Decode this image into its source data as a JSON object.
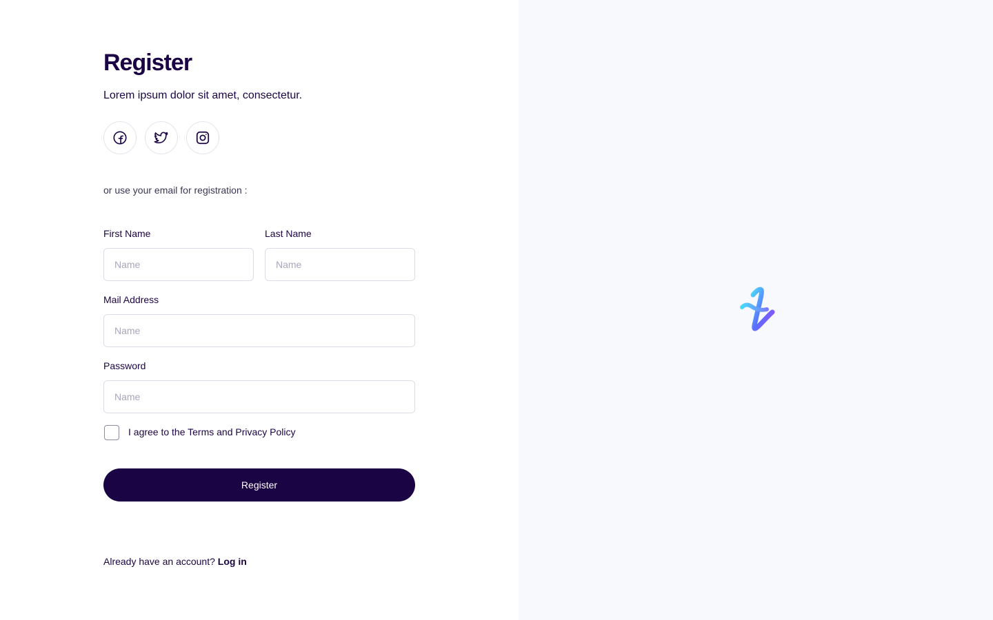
{
  "form": {
    "title": "Register",
    "subtitle": "Lorem ipsum dolor sit amet, consectetur.",
    "social": [
      {
        "icon": "facebook-icon"
      },
      {
        "icon": "twitter-icon"
      },
      {
        "icon": "instagram-icon"
      }
    ],
    "divider_text": "or use your email for registration :",
    "first_name": {
      "label": "First Name",
      "placeholder": "Name",
      "value": ""
    },
    "last_name": {
      "label": "Last Name",
      "placeholder": "Name",
      "value": ""
    },
    "email": {
      "label": "Mail Address",
      "placeholder": "Name",
      "value": ""
    },
    "password": {
      "label": "Password",
      "placeholder": "Name",
      "value": ""
    },
    "terms": {
      "label": "I agree to the Terms and Privacy Policy",
      "checked": false
    },
    "submit_label": "Register",
    "footer": {
      "prompt": "Already have an account?",
      "link": "Log in"
    }
  },
  "brand": {
    "logo_icon": "brand-logo-icon"
  },
  "colors": {
    "primary": "#1b0444",
    "panel_bg": "#f8f9fc",
    "border": "#dcdce6",
    "placeholder": "#a9a6bd"
  }
}
